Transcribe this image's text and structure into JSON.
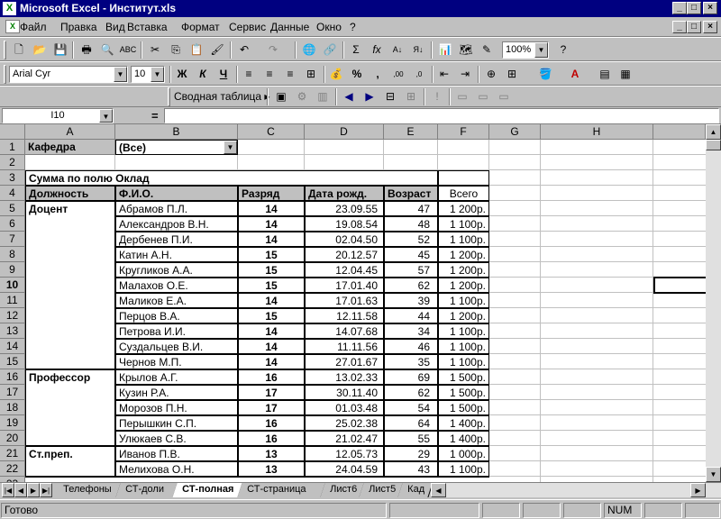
{
  "window": {
    "title": "Microsoft Excel - Институт.xls"
  },
  "menu": [
    "Файл",
    "Правка",
    "Вид",
    "Вставка",
    "Формат",
    "Сервис",
    "Данные",
    "Окно",
    "?"
  ],
  "toolbar": {
    "zoom": "100%",
    "font": "Arial Cyr",
    "size": "10",
    "pivot_label": "Сводная таблица"
  },
  "formula": {
    "name_box": "I10",
    "equals": "=",
    "value": ""
  },
  "columns": [
    "A",
    "B",
    "C",
    "D",
    "E",
    "F",
    "G",
    "H"
  ],
  "filter": {
    "label": "Кафедра",
    "value": "(Все)"
  },
  "sum_title": "Сумма по полю Оклад",
  "headers": {
    "dolzh": "Должность",
    "fio": "Ф.И.О.",
    "razryad": "Разряд",
    "date": "Дата рожд.",
    "age": "Возраст",
    "total": "Всего"
  },
  "rows": [
    {
      "n": "5",
      "pos": "Доцент",
      "fio": "Абрамов П.Л.",
      "rank": "14",
      "date": "23.09.55",
      "age": "47",
      "total": "1 200р."
    },
    {
      "n": "6",
      "pos": "",
      "fio": "Александров В.Н.",
      "rank": "14",
      "date": "19.08.54",
      "age": "48",
      "total": "1 100р."
    },
    {
      "n": "7",
      "pos": "",
      "fio": "Дербенев П.И.",
      "rank": "14",
      "date": "02.04.50",
      "age": "52",
      "total": "1 100р."
    },
    {
      "n": "8",
      "pos": "",
      "fio": "Катин А.Н.",
      "rank": "15",
      "date": "20.12.57",
      "age": "45",
      "total": "1 200р."
    },
    {
      "n": "9",
      "pos": "",
      "fio": "Кругликов А.А.",
      "rank": "15",
      "date": "12.04.45",
      "age": "57",
      "total": "1 200р."
    },
    {
      "n": "10",
      "pos": "",
      "fio": "Малахов О.Е.",
      "rank": "15",
      "date": "17.01.40",
      "age": "62",
      "total": "1 200р."
    },
    {
      "n": "11",
      "pos": "",
      "fio": "Маликов Е.А.",
      "rank": "14",
      "date": "17.01.63",
      "age": "39",
      "total": "1 100р."
    },
    {
      "n": "12",
      "pos": "",
      "fio": "Перцов В.А.",
      "rank": "15",
      "date": "12.11.58",
      "age": "44",
      "total": "1 200р."
    },
    {
      "n": "13",
      "pos": "",
      "fio": "Петрова И.И.",
      "rank": "14",
      "date": "14.07.68",
      "age": "34",
      "total": "1 100р."
    },
    {
      "n": "14",
      "pos": "",
      "fio": "Суздальцев В.И.",
      "rank": "14",
      "date": "11.11.56",
      "age": "46",
      "total": "1 100р."
    },
    {
      "n": "15",
      "pos": "",
      "fio": "Чернов М.П.",
      "rank": "14",
      "date": "27.01.67",
      "age": "35",
      "total": "1 100р."
    },
    {
      "n": "16",
      "pos": "Профессор",
      "fio": "Крылов А.Г.",
      "rank": "16",
      "date": "13.02.33",
      "age": "69",
      "total": "1 500р."
    },
    {
      "n": "17",
      "pos": "",
      "fio": "Кузин Р.А.",
      "rank": "17",
      "date": "30.11.40",
      "age": "62",
      "total": "1 500р."
    },
    {
      "n": "18",
      "pos": "",
      "fio": "Морозов П.Н.",
      "rank": "17",
      "date": "01.03.48",
      "age": "54",
      "total": "1 500р."
    },
    {
      "n": "19",
      "pos": "",
      "fio": "Перышкин С.П.",
      "rank": "16",
      "date": "25.02.38",
      "age": "64",
      "total": "1 400р."
    },
    {
      "n": "20",
      "pos": "",
      "fio": "Улюкаев С.В.",
      "rank": "16",
      "date": "21.02.47",
      "age": "55",
      "total": "1 400р."
    },
    {
      "n": "21",
      "pos": "Ст.преп.",
      "fio": "Иванов П.В.",
      "rank": "13",
      "date": "12.05.73",
      "age": "29",
      "total": "1 000р."
    },
    {
      "n": "22",
      "pos": "",
      "fio": "Мелихова О.Н.",
      "rank": "13",
      "date": "24.04.59",
      "age": "43",
      "total": "1 100р."
    }
  ],
  "sheets": [
    "Телефоны",
    "СТ-доли",
    "СТ-полная",
    "СТ-страница",
    "Лист6",
    "Лист5",
    "Кад"
  ],
  "active_sheet": "СТ-полная",
  "status": {
    "ready": "Готово",
    "num": "NUM"
  }
}
